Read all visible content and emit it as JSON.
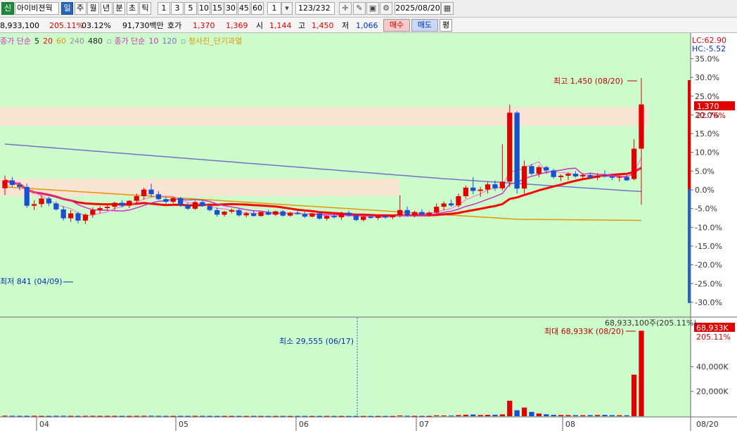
{
  "toolbar": {
    "badge": "신",
    "stock_name": "아이비젼웍",
    "periods": [
      "일",
      "주",
      "월",
      "년",
      "분",
      "초",
      "틱"
    ],
    "active_period": "일",
    "intervals": [
      "1",
      "3",
      "5",
      "10",
      "15",
      "30",
      "45",
      "60"
    ],
    "count_value": "1",
    "range_value": "123",
    "range_total": "/232",
    "date": "2025/08/20",
    "icons": [
      "crosshair-icon",
      "draw-icon",
      "save-icon",
      "gear-icon"
    ]
  },
  "quote": {
    "volume": "8,933,100",
    "vol_ratio": "205.11%",
    "turnover": "03.12%",
    "amount": "91,730백만",
    "ask_label": "호가",
    "ask": "1,370",
    "bid": "1,369",
    "open_label": "시",
    "open": "1,144",
    "high_label": "고",
    "high": "1,450",
    "low_label": "저",
    "low": "1,066",
    "buy_label": "매수",
    "sell_label": "매도",
    "eval_label": "평"
  },
  "legend": {
    "ma_group1": "종가 단순",
    "ma_group1_periods": [
      {
        "p": "5",
        "color": "#1a1a1a"
      },
      {
        "p": "20",
        "color": "#ff0000"
      },
      {
        "p": "60",
        "color": "#e69500"
      },
      {
        "p": "240",
        "color": "#909090"
      },
      {
        "p": "480",
        "color": "#1a1a1a"
      }
    ],
    "ma_group2": "종가 단순",
    "ma_group2_periods": [
      {
        "p": "10",
        "color": "#d030c0"
      },
      {
        "p": "120",
        "color": "#7a6fc0"
      }
    ],
    "signal": "청사진_단기과열"
  },
  "chart_data": {
    "type": "candlestick",
    "x_ticks": [
      "04",
      "05",
      "06",
      "07",
      "08"
    ],
    "x_end_label": "08/20",
    "y_pct_ticks": [
      "35.0%",
      "30.0%",
      "25.0%",
      "20.0%",
      "15.0%",
      "10.0%",
      "5.0%",
      "0.0%",
      "-5.0%",
      "-10.0%",
      "-15.0%",
      "-20.0%",
      "-25.0%",
      "-30.0%"
    ],
    "y_pct_values": [
      35,
      30,
      25,
      20,
      15,
      10,
      5,
      0,
      -5,
      -10,
      -15,
      -20,
      -25,
      -30
    ],
    "lc": "LC:62.90",
    "hc": "HC:-5.52",
    "current_price_label": "1,370",
    "current_pct_label": "22.76%",
    "high_annotation": "최고 1,450 (08/20)",
    "low_annotation": "최저 841 (04/09)",
    "price_candles": [
      [
        1116,
        1155,
        1096,
        1140
      ],
      [
        1140,
        1150,
        1120,
        1126
      ],
      [
        1126,
        1135,
        1110,
        1120
      ],
      [
        1120,
        1130,
        1056,
        1063
      ],
      [
        1063,
        1080,
        1050,
        1068
      ],
      [
        1068,
        1095,
        1058,
        1085
      ],
      [
        1085,
        1090,
        1062,
        1070
      ],
      [
        1070,
        1076,
        1048,
        1052
      ],
      [
        1052,
        1062,
        1018,
        1025
      ],
      [
        1025,
        1050,
        1014,
        1040
      ],
      [
        1040,
        1045,
        1010,
        1018
      ],
      [
        1018,
        1040,
        1008,
        1036
      ],
      [
        1036,
        1058,
        1026,
        1050
      ],
      [
        1050,
        1062,
        1040,
        1056
      ],
      [
        1056,
        1064,
        1048,
        1060
      ],
      [
        1060,
        1075,
        1050,
        1072
      ],
      [
        1072,
        1080,
        1058,
        1063
      ],
      [
        1063,
        1080,
        1056,
        1078
      ],
      [
        1078,
        1100,
        1070,
        1092
      ],
      [
        1092,
        1118,
        1082,
        1112
      ],
      [
        1112,
        1130,
        1090,
        1098
      ],
      [
        1098,
        1108,
        1080,
        1083
      ],
      [
        1083,
        1090,
        1068,
        1075
      ],
      [
        1075,
        1090,
        1070,
        1086
      ],
      [
        1086,
        1090,
        1060,
        1065
      ],
      [
        1065,
        1072,
        1050,
        1054
      ],
      [
        1054,
        1078,
        1050,
        1074
      ],
      [
        1074,
        1080,
        1060,
        1062
      ],
      [
        1062,
        1068,
        1046,
        1050
      ],
      [
        1050,
        1058,
        1030,
        1036
      ],
      [
        1036,
        1048,
        1030,
        1045
      ],
      [
        1045,
        1055,
        1040,
        1050
      ],
      [
        1050,
        1054,
        1030,
        1034
      ],
      [
        1034,
        1045,
        1028,
        1040
      ],
      [
        1040,
        1050,
        1030,
        1032
      ],
      [
        1032,
        1045,
        1030,
        1044
      ],
      [
        1044,
        1050,
        1034,
        1036
      ],
      [
        1036,
        1048,
        1032,
        1046
      ],
      [
        1046,
        1050,
        1030,
        1033
      ],
      [
        1033,
        1045,
        1030,
        1042
      ],
      [
        1042,
        1050,
        1036,
        1038
      ],
      [
        1038,
        1044,
        1026,
        1030
      ],
      [
        1030,
        1042,
        1028,
        1040
      ],
      [
        1040,
        1042,
        1020,
        1024
      ],
      [
        1024,
        1034,
        1018,
        1032
      ],
      [
        1032,
        1040,
        1024,
        1028
      ],
      [
        1028,
        1045,
        1020,
        1042
      ],
      [
        1042,
        1048,
        1030,
        1034
      ],
      [
        1034,
        1036,
        1016,
        1020
      ],
      [
        1020,
        1032,
        1016,
        1030
      ],
      [
        1030,
        1038,
        1024,
        1026
      ],
      [
        1026,
        1034,
        1020,
        1032
      ],
      [
        1032,
        1036,
        1024,
        1028
      ],
      [
        1028,
        1036,
        1022,
        1034
      ],
      [
        1034,
        1095,
        1028,
        1050
      ],
      [
        1050,
        1060,
        1030,
        1034
      ],
      [
        1034,
        1048,
        1028,
        1044
      ],
      [
        1044,
        1052,
        1034,
        1036
      ],
      [
        1036,
        1046,
        1030,
        1042
      ],
      [
        1042,
        1070,
        1035,
        1060
      ],
      [
        1060,
        1076,
        1050,
        1070
      ],
      [
        1070,
        1082,
        1060,
        1064
      ],
      [
        1064,
        1100,
        1058,
        1092
      ],
      [
        1092,
        1125,
        1085,
        1118
      ],
      [
        1118,
        1150,
        1098,
        1108
      ],
      [
        1108,
        1120,
        1090,
        1112
      ],
      [
        1112,
        1135,
        1100,
        1128
      ],
      [
        1128,
        1140,
        1108,
        1116
      ],
      [
        1116,
        1250,
        1110,
        1136
      ],
      [
        1136,
        1370,
        1120,
        1345
      ],
      [
        1345,
        1350,
        1100,
        1115
      ],
      [
        1115,
        1200,
        1100,
        1183
      ],
      [
        1183,
        1190,
        1155,
        1160
      ],
      [
        1160,
        1185,
        1150,
        1180
      ],
      [
        1180,
        1184,
        1160,
        1170
      ],
      [
        1170,
        1175,
        1145,
        1150
      ],
      [
        1150,
        1158,
        1138,
        1154
      ],
      [
        1154,
        1164,
        1140,
        1160
      ],
      [
        1160,
        1168,
        1148,
        1152
      ],
      [
        1152,
        1162,
        1144,
        1156
      ],
      [
        1156,
        1164,
        1146,
        1148
      ],
      [
        1148,
        1162,
        1140,
        1154
      ],
      [
        1154,
        1170,
        1148,
        1152
      ],
      [
        1152,
        1160,
        1140,
        1148
      ],
      [
        1148,
        1156,
        1136,
        1150
      ],
      [
        1150,
        1156,
        1138,
        1140
      ],
      [
        1144,
        1265,
        1140,
        1236
      ],
      [
        1236,
        1450,
        1066,
        1370
      ]
    ],
    "price_scale": {
      "min": 830,
      "max": 1450
    },
    "volume_max_label": "68,933,100주(205.11%)",
    "volume_max_annotation": "최대 68,933K (08/20)",
    "volume_min_annotation": "최소 29,555 (06/17)",
    "volume_current_label": "68,933K",
    "volume_current_pct": "205.11%",
    "volume_ticks": [
      "40,000K",
      "20,000K"
    ],
    "volume_values_k": [
      420,
      380,
      350,
      310,
      340,
      300,
      280,
      360,
      400,
      330,
      300,
      320,
      350,
      300,
      290,
      310,
      300,
      280,
      340,
      360,
      420,
      350,
      300,
      280,
      310,
      290,
      330,
      300,
      280,
      260,
      250,
      270,
      240,
      230,
      250,
      240,
      230,
      220,
      240,
      230,
      250,
      240,
      230,
      220,
      240,
      230,
      220,
      210,
      230,
      220,
      200,
      210,
      230,
      220,
      600,
      380,
      300,
      280,
      260,
      700,
      600,
      520,
      900,
      1200,
      1400,
      1000,
      1100,
      1200,
      1500,
      12500,
      4800,
      7000,
      3500,
      2200,
      1600,
      1100,
      1000,
      900,
      850,
      800,
      900,
      1000,
      1100,
      900,
      800,
      750,
      33500,
      68933
    ],
    "volume_scale": {
      "min": 0,
      "max": 72000
    }
  }
}
